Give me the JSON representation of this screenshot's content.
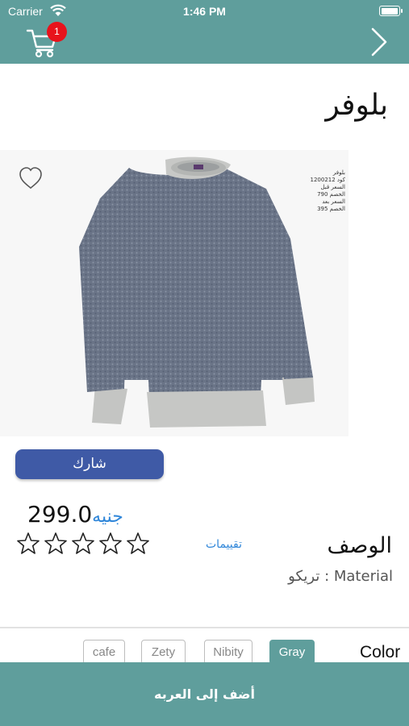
{
  "status_bar": {
    "carrier": "Carrier",
    "time": "1:46 PM",
    "battery_level": 1.0
  },
  "nav": {
    "cart_icon": "cart-icon",
    "cart_badge": "1",
    "forward_icon": "chevron-right-icon",
    "accent_color": "#5f9e9c"
  },
  "product": {
    "title": "بلوفر",
    "image_icon": "sweater-image",
    "favorite_icon": "heart-outline-icon",
    "sticker_lines": [
      "بلوفر",
      "كود 1200212",
      "السعر قبل",
      "الخصم 790",
      "السعر بعد",
      "الخصم 395"
    ],
    "share_label": "شارك",
    "price_value": "299.0",
    "price_currency": "جنيه",
    "rating": {
      "value": 0,
      "max": 5,
      "icon": "star-outline-icon"
    },
    "reviews_label": "تقييمات",
    "description_label": "الوصف",
    "material_text": "Material : تريكو"
  },
  "colors": {
    "label": "Color",
    "options": [
      "Gray",
      "Nibity",
      "Zety",
      "cafe"
    ],
    "selected": "Gray"
  },
  "footer": {
    "add_to_cart_label": "أضف إلى العربه"
  }
}
